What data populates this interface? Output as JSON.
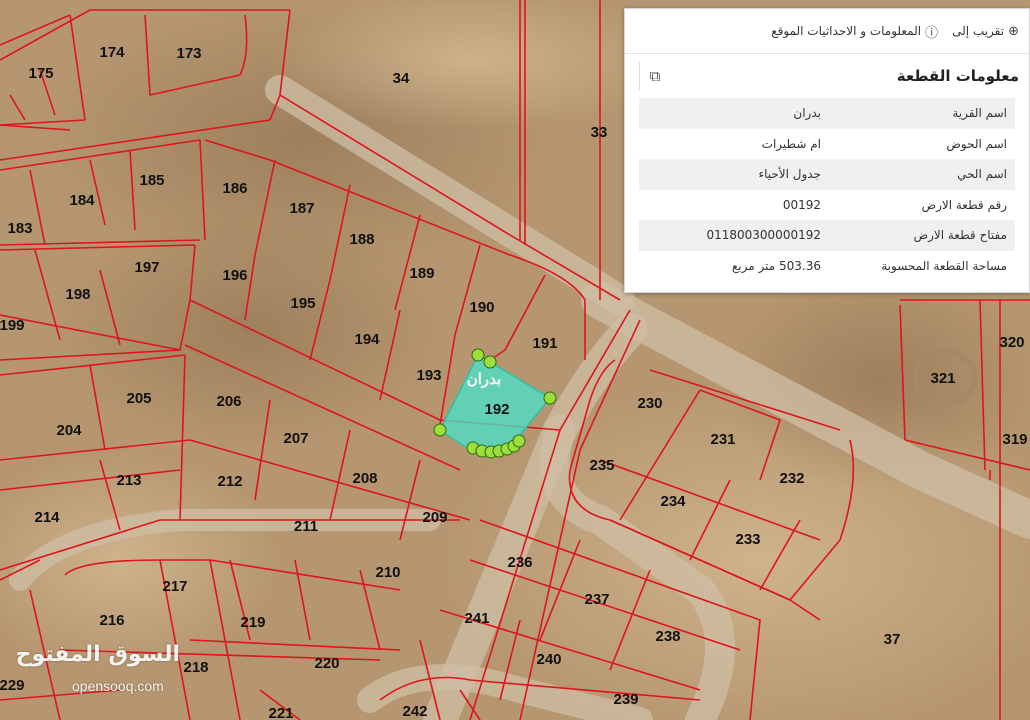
{
  "panel": {
    "toolbar": {
      "zoom_to": "تقريب إلى",
      "info_coords": "المعلومات و الاحداثيات الموقع"
    },
    "title": "معلومات القطعة",
    "rows": [
      {
        "key": "اسم القرية",
        "value": "بدران"
      },
      {
        "key": "اسم الحوض",
        "value": "ام شطيرات"
      },
      {
        "key": "اسم الحي",
        "value": "جدول الأحياء"
      },
      {
        "key": "رقم قطعة الارض",
        "value": "00192"
      },
      {
        "key": "مفتاح قطعة الارض",
        "value": "011800300000192"
      },
      {
        "key": "مساحة القطعة المحسوبة",
        "value": "503.36 متر مربع"
      }
    ]
  },
  "map": {
    "selected_parcel_label": "بدران",
    "parcels": [
      "175",
      "174",
      "173",
      "34",
      "33",
      "185",
      "184",
      "183",
      "186",
      "187",
      "188",
      "189",
      "190",
      "191",
      "197",
      "198",
      "199",
      "196",
      "195",
      "194",
      "193",
      "192",
      "205",
      "206",
      "204",
      "207",
      "213",
      "212",
      "208",
      "209",
      "214",
      "211",
      "210",
      "217",
      "216",
      "219",
      "218",
      "220",
      "221",
      "230",
      "231",
      "232",
      "235",
      "234",
      "233",
      "236",
      "237",
      "241",
      "238",
      "240",
      "239",
      "242",
      "229",
      "320",
      "321",
      "319",
      "37"
    ]
  },
  "watermark": {
    "arabic": "السوق المفتوح",
    "latin": "opensooq.com"
  },
  "colors": {
    "parcel_line": "#e0141c",
    "selection_fill": "#49e0c8",
    "vertex": "#9cde3a",
    "map_base": "#b59670"
  }
}
